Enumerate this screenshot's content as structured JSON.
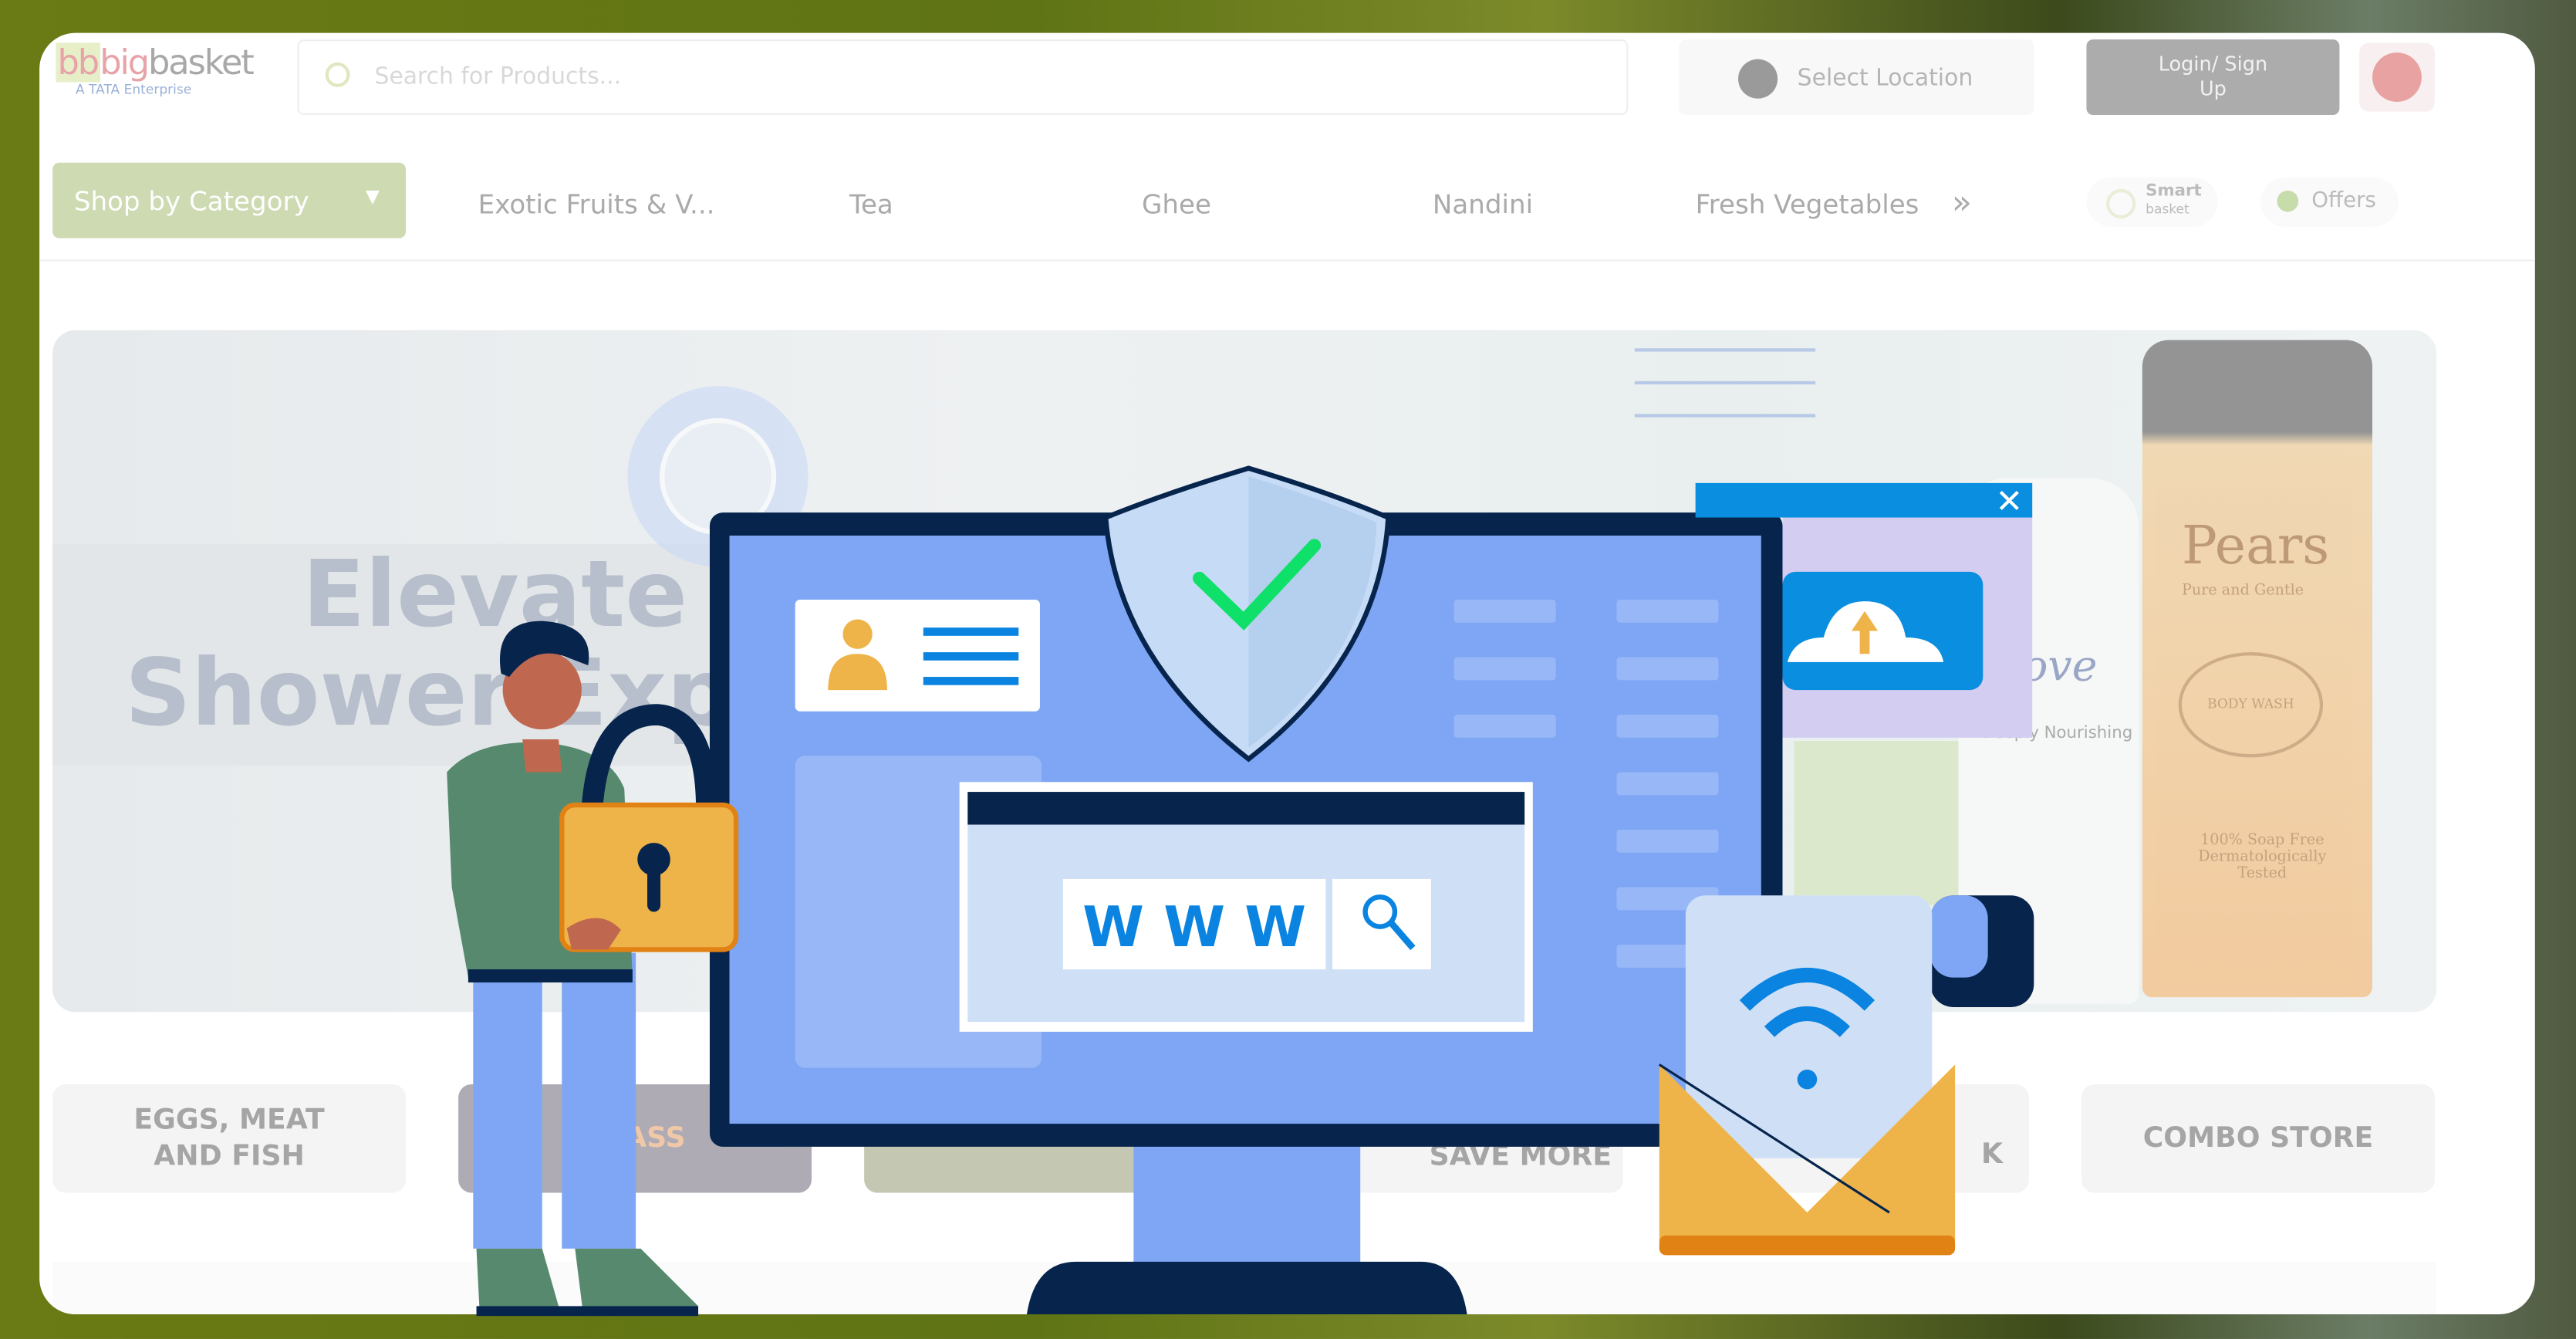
{
  "header": {
    "logo": {
      "brand_part1": "bb",
      "brand_part2": "big",
      "brand_part3": "basket",
      "tagline": "A TATA Enterprise"
    },
    "search": {
      "placeholder": "Search for Products..."
    },
    "location_label": "Select Location",
    "login_label_line1": "Login/ Sign",
    "login_label_line2": "Up"
  },
  "nav": {
    "shop_by_category": "Shop by Category",
    "items": [
      "Exotic Fruits & V...",
      "Tea",
      "Ghee",
      "Nandini",
      "Fresh Vegetables"
    ],
    "more": "»",
    "smart_basket_line1": "Smart",
    "smart_basket_line2": "basket",
    "offers": "Offers"
  },
  "banner": {
    "line1": "Elevate",
    "line2": "Shower Exp",
    "product_pears": "Pears",
    "product_pears_sub": "Pure and Gentle",
    "product_dove": "Dove",
    "product_dove_sub": "Deeply Nourishing",
    "product_pears_badge": "BODY WASH",
    "product_pears_footer1": "100% Soap Free",
    "product_pears_footer2": "Dermatologically Tested"
  },
  "tiles": [
    {
      "label_line1": "EGGS, MEAT",
      "label_line2": "AND FISH"
    },
    {
      "label_line1": "UPASS",
      "label_line2": ""
    },
    {
      "label_line1": "",
      "label_line2": ""
    },
    {
      "label_line1": "SAVE MORE",
      "label_line2": ""
    },
    {
      "label_line1": "K",
      "label_line2": ""
    },
    {
      "label_line1": "COMBO STORE",
      "label_line2": ""
    }
  ],
  "illustration": {
    "browser_text": "W W W"
  },
  "colors": {
    "brand_green": "#cddab2",
    "login_grey": "#acacac",
    "monitor_blue": "#7ea6f4",
    "navy": "#06244c",
    "check_green": "#0fe06a",
    "envelope_yellow": "#eeb449"
  }
}
